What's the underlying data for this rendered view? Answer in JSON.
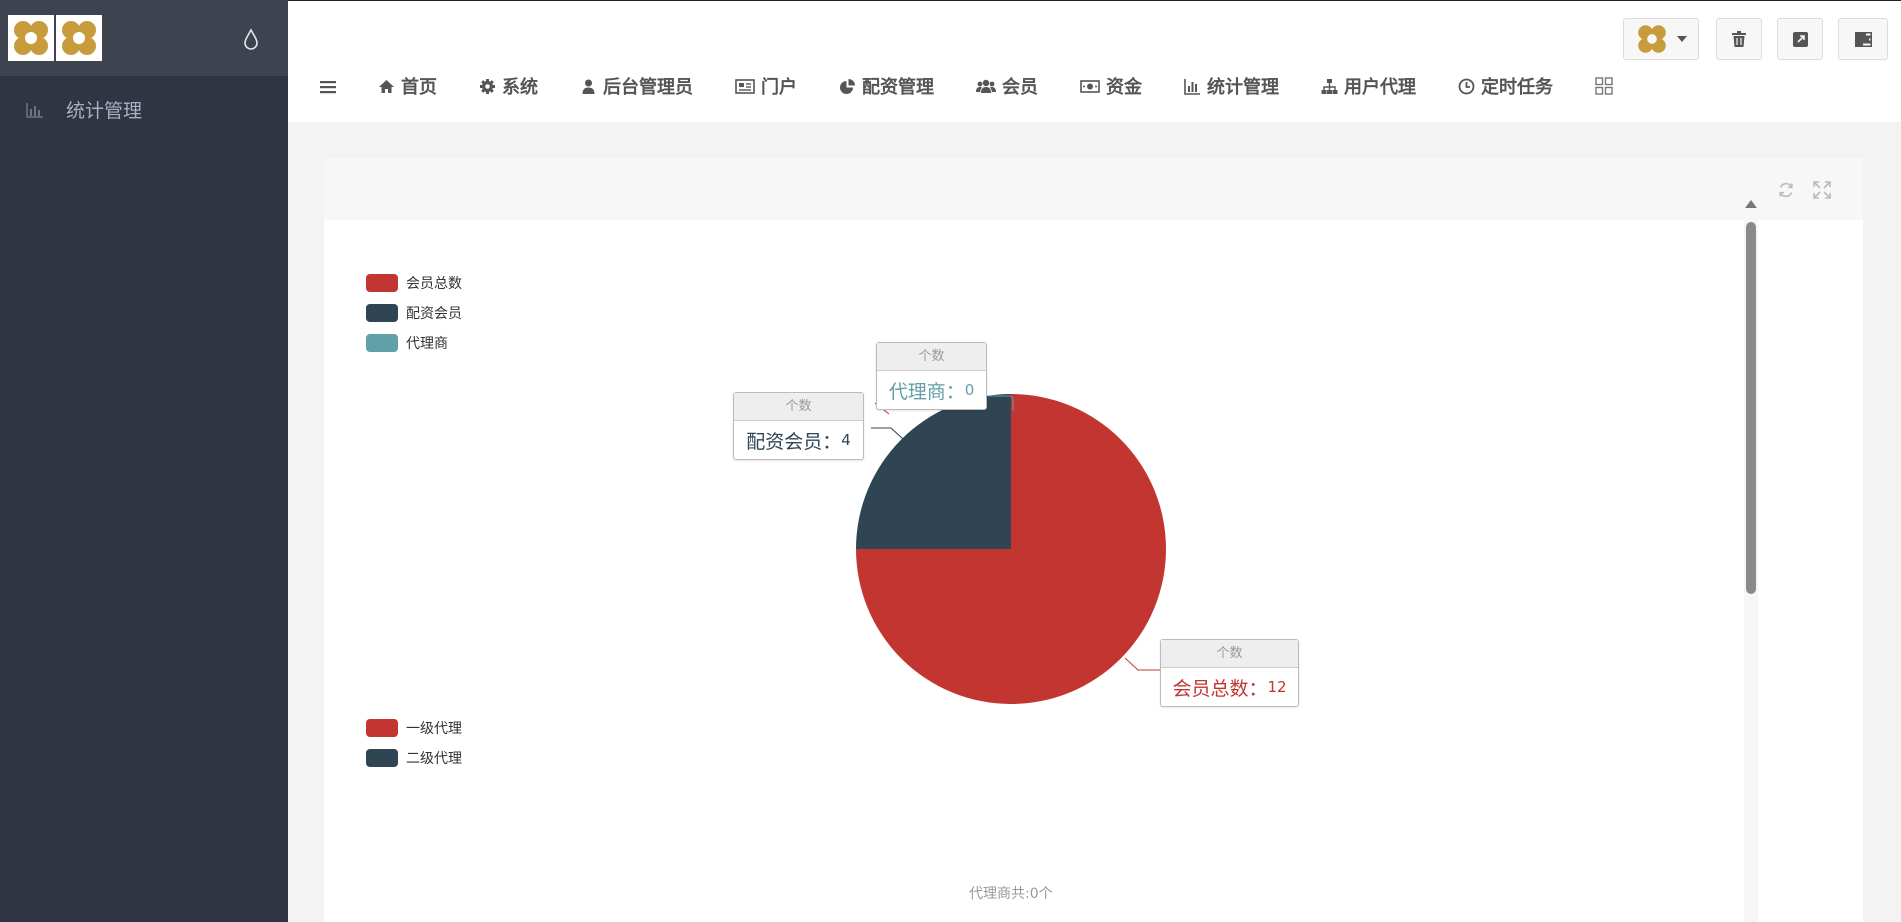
{
  "sidebar": {
    "items": [
      {
        "label": "统计管理",
        "icon": "bar-chart-icon"
      }
    ]
  },
  "nav": {
    "items": [
      {
        "label": "首页",
        "icon": "home-icon"
      },
      {
        "label": "系统",
        "icon": "gear-icon"
      },
      {
        "label": "后台管理员",
        "icon": "user-icon"
      },
      {
        "label": "门户",
        "icon": "newspaper-icon"
      },
      {
        "label": "配资管理",
        "icon": "pie-chart-icon"
      },
      {
        "label": "会员",
        "icon": "users-icon"
      },
      {
        "label": "资金",
        "icon": "money-icon"
      },
      {
        "label": "统计管理",
        "icon": "bar-chart-icon"
      },
      {
        "label": "用户代理",
        "icon": "sitemap-icon"
      },
      {
        "label": "定时任务",
        "icon": "clock-icon"
      }
    ]
  },
  "chart_data": [
    {
      "type": "pie",
      "categories": [
        "会员总数",
        "配资会员",
        "代理商"
      ],
      "values": [
        12,
        4,
        0
      ],
      "label_header": "个数",
      "colors": [
        "#c23531",
        "#2f4554",
        "#61a0a8"
      ],
      "legend": "top-left"
    },
    {
      "type": "pie",
      "categories": [
        "一级代理",
        "二级代理"
      ],
      "colors": [
        "#c23531",
        "#2f4554"
      ],
      "note": "代理商共:0个",
      "legend": "top-left"
    }
  ]
}
